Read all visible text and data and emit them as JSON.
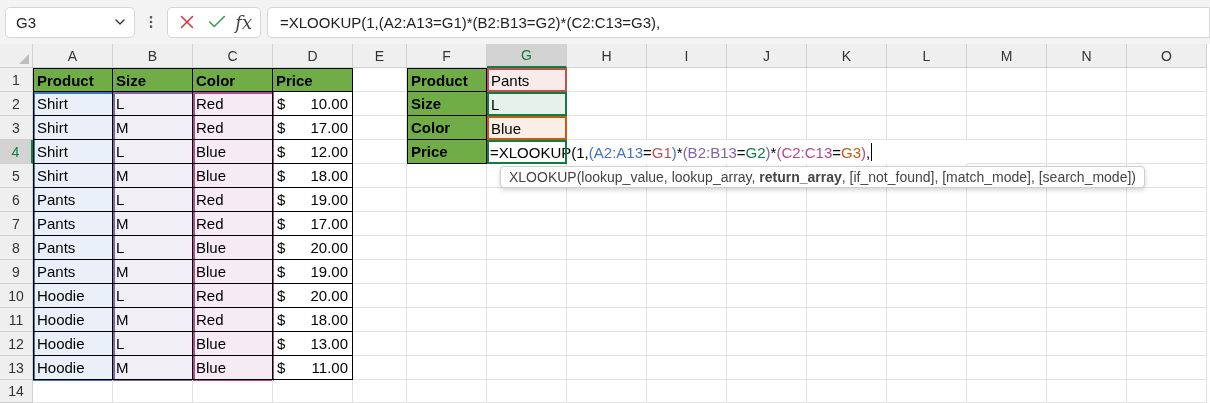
{
  "name_box": {
    "value": "G3"
  },
  "formula_bar": {
    "function_label": "fx",
    "value": "=XLOOKUP(1,(A2:A13=G1)*(B2:B13=G2)*(C2:C13=G3),"
  },
  "column_headers": [
    {
      "label": "A",
      "selected": false
    },
    {
      "label": "B",
      "selected": false
    },
    {
      "label": "C",
      "selected": false
    },
    {
      "label": "D",
      "selected": false
    },
    {
      "label": "E",
      "selected": false
    },
    {
      "label": "F",
      "selected": false
    },
    {
      "label": "G",
      "selected": true
    },
    {
      "label": "H",
      "selected": false
    },
    {
      "label": "I",
      "selected": false
    },
    {
      "label": "J",
      "selected": false
    },
    {
      "label": "K",
      "selected": false
    },
    {
      "label": "L",
      "selected": false
    },
    {
      "label": "M",
      "selected": false
    },
    {
      "label": "N",
      "selected": false
    },
    {
      "label": "O",
      "selected": false
    }
  ],
  "row_headers": [
    {
      "label": "1",
      "selected": false
    },
    {
      "label": "2",
      "selected": false
    },
    {
      "label": "3",
      "selected": false
    },
    {
      "label": "4",
      "selected": true
    },
    {
      "label": "5",
      "selected": false
    },
    {
      "label": "6",
      "selected": false
    },
    {
      "label": "7",
      "selected": false
    },
    {
      "label": "8",
      "selected": false
    },
    {
      "label": "9",
      "selected": false
    },
    {
      "label": "10",
      "selected": false
    },
    {
      "label": "11",
      "selected": false
    },
    {
      "label": "12",
      "selected": false
    },
    {
      "label": "13",
      "selected": false
    },
    {
      "label": "14",
      "selected": false
    }
  ],
  "data_table": {
    "columns": [
      {
        "label": "Product",
        "color": "#4472c4"
      },
      {
        "label": "Size",
        "color": "#8064a2"
      },
      {
        "label": "Color",
        "color": "#b04a8c"
      },
      {
        "label": "Price"
      }
    ],
    "rows": [
      {
        "cells": [
          "Shirt",
          "L",
          "Red"
        ],
        "currency": "$",
        "amount": "10.00"
      },
      {
        "cells": [
          "Shirt",
          "M",
          "Red"
        ],
        "currency": "$",
        "amount": "17.00"
      },
      {
        "cells": [
          "Shirt",
          "L",
          "Blue"
        ],
        "currency": "$",
        "amount": "12.00"
      },
      {
        "cells": [
          "Shirt",
          "M",
          "Blue"
        ],
        "currency": "$",
        "amount": "18.00"
      },
      {
        "cells": [
          "Pants",
          "L",
          "Red"
        ],
        "currency": "$",
        "amount": "19.00"
      },
      {
        "cells": [
          "Pants",
          "M",
          "Red"
        ],
        "currency": "$",
        "amount": "17.00"
      },
      {
        "cells": [
          "Pants",
          "L",
          "Blue"
        ],
        "currency": "$",
        "amount": "20.00"
      },
      {
        "cells": [
          "Pants",
          "M",
          "Blue"
        ],
        "currency": "$",
        "amount": "19.00"
      },
      {
        "cells": [
          "Hoodie",
          "L",
          "Red"
        ],
        "currency": "$",
        "amount": "20.00"
      },
      {
        "cells": [
          "Hoodie",
          "M",
          "Red"
        ],
        "currency": "$",
        "amount": "18.00"
      },
      {
        "cells": [
          "Hoodie",
          "L",
          "Blue"
        ],
        "currency": "$",
        "amount": "13.00"
      },
      {
        "cells": [
          "Hoodie",
          "M",
          "Blue"
        ],
        "currency": "$",
        "amount": "11.00"
      }
    ]
  },
  "lookup": {
    "rows": [
      {
        "kind": "value",
        "label": "Product",
        "value": "Pants",
        "color": "#c0504d"
      },
      {
        "kind": "value",
        "label": "Size",
        "value": "L",
        "color": "#107c41"
      },
      {
        "kind": "value",
        "label": "Color",
        "value": "Blue",
        "color": "#c55a11"
      },
      {
        "kind": "formula",
        "label": "Price",
        "segments": [
          {
            "text": "=XLOOKUP(1,"
          },
          {
            "text": "(A2:A13",
            "color": "#4472c4"
          },
          {
            "text": "="
          },
          {
            "text": "G1",
            "color": "#c0504d"
          },
          {
            "text": ")",
            "color": "#4472c4"
          },
          {
            "text": "*"
          },
          {
            "text": "(B2:B13",
            "color": "#8064a2"
          },
          {
            "text": "="
          },
          {
            "text": "G2",
            "color": "#107c41"
          },
          {
            "text": ")",
            "color": "#8064a2"
          },
          {
            "text": "*"
          },
          {
            "text": "(C2:C13",
            "color": "#b04a8c"
          },
          {
            "text": "="
          },
          {
            "text": "G3",
            "color": "#c55a11"
          },
          {
            "text": ")",
            "color": "#b04a8c"
          },
          {
            "text": ","
          }
        ]
      }
    ]
  },
  "tooltip": {
    "text": "XLOOKUP(lookup_value, lookup_array, **return_array**, [if_not_found], [match_mode], [search_mode])"
  }
}
